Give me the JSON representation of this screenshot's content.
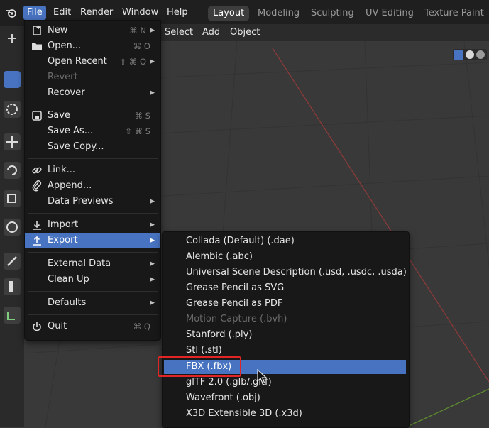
{
  "topbar": {
    "menus": [
      "File",
      "Edit",
      "Render",
      "Window",
      "Help"
    ],
    "workspaces": [
      "Layout",
      "Modeling",
      "Sculpting",
      "UV Editing",
      "Texture Paint"
    ],
    "active_workspace": "Layout",
    "active_menu": "File"
  },
  "viewport_header": {
    "items": [
      "Select",
      "Add",
      "Object"
    ]
  },
  "file_menu": {
    "items": [
      {
        "label": "New",
        "shortcut": "⌘ N",
        "submenu": true,
        "icon": "new-file-icon"
      },
      {
        "label": "Open...",
        "shortcut": "⌘ O",
        "icon": "folder-icon"
      },
      {
        "label": "Open Recent",
        "shortcut": "⇧ ⌘ O",
        "submenu": true
      },
      {
        "label": "Revert",
        "disabled": true
      },
      {
        "label": "Recover",
        "submenu": true
      },
      {
        "label": "Save",
        "shortcut": "⌘ S",
        "icon": "save-icon"
      },
      {
        "label": "Save As...",
        "shortcut": "⇧ ⌘ S"
      },
      {
        "label": "Save Copy..."
      },
      {
        "label": "Link...",
        "icon": "link-icon"
      },
      {
        "label": "Append...",
        "icon": "append-icon"
      },
      {
        "label": "Data Previews",
        "submenu": true
      },
      {
        "label": "Import",
        "submenu": true,
        "icon": "import-icon"
      },
      {
        "label": "Export",
        "submenu": true,
        "icon": "export-icon",
        "highlighted": true
      },
      {
        "label": "External Data",
        "submenu": true
      },
      {
        "label": "Clean Up",
        "submenu": true
      },
      {
        "label": "Defaults",
        "submenu": true
      },
      {
        "label": "Quit",
        "shortcut": "⌘ Q",
        "icon": "power-icon"
      }
    ]
  },
  "export_menu": {
    "items": [
      {
        "label": "Collada (Default) (.dae)"
      },
      {
        "label": "Alembic (.abc)"
      },
      {
        "label": "Universal Scene Description (.usd, .usdc, .usda)"
      },
      {
        "label": "Grease Pencil as SVG"
      },
      {
        "label": "Grease Pencil as PDF"
      },
      {
        "label": "Motion Capture (.bvh)",
        "disabled": true
      },
      {
        "label": "Stanford (.ply)"
      },
      {
        "label": "Stl (.stl)"
      },
      {
        "label": "FBX (.fbx)",
        "highlighted": true
      },
      {
        "label": "glTF 2.0 (.glb/.gltf)"
      },
      {
        "label": "Wavefront (.obj)"
      },
      {
        "label": "X3D Extensible 3D (.x3d)"
      }
    ]
  },
  "colors": {
    "accent": "#4873c0",
    "annotation_box": "#e12424",
    "menu_bg": "#181818"
  }
}
